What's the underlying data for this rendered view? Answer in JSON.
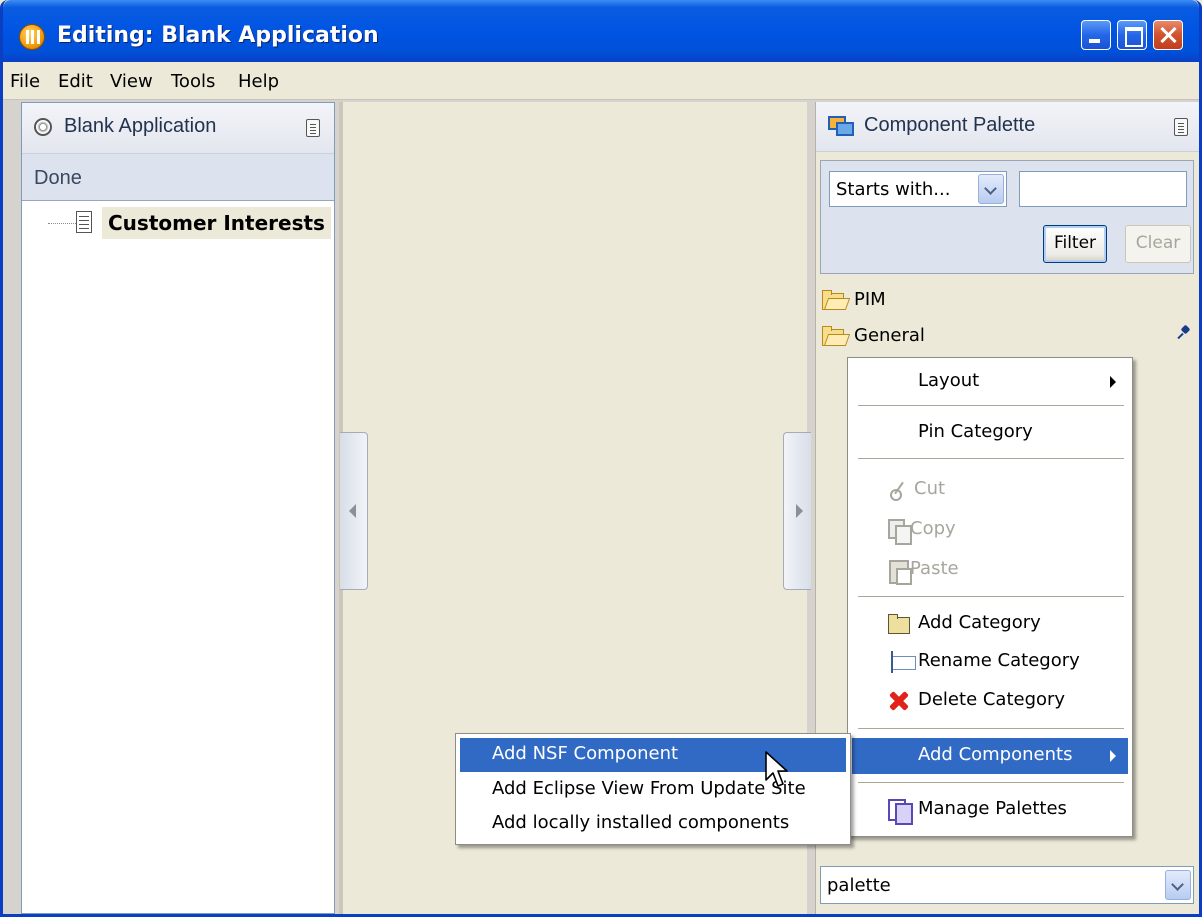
{
  "window": {
    "title": "Editing: Blank Application"
  },
  "menubar": {
    "items": [
      "File",
      "Edit",
      "View",
      "Tools",
      "Help"
    ]
  },
  "left_panel": {
    "title": "Blank Application",
    "status": "Done",
    "tree": [
      {
        "label": "Customer Interests"
      }
    ]
  },
  "right_panel": {
    "title": "Component Palette",
    "filter_mode": "Starts with...",
    "filter_text": "",
    "filter_button": "Filter",
    "clear_button": "Clear",
    "categories": [
      {
        "label": "PIM",
        "pinned": false
      },
      {
        "label": "General",
        "pinned": true
      }
    ],
    "palette_select": "palette"
  },
  "context_menu": {
    "items": [
      {
        "label": "Layout",
        "submenu": true
      },
      {
        "label": "Pin Category"
      },
      {
        "label": "Cut",
        "icon": "scissors-icon",
        "disabled": true
      },
      {
        "label": "Copy",
        "icon": "copy-icon",
        "disabled": true
      },
      {
        "label": "Paste",
        "icon": "paste-icon",
        "disabled": true
      },
      {
        "label": "Add Category",
        "icon": "folder-icon"
      },
      {
        "label": "Rename Category",
        "icon": "rename-icon"
      },
      {
        "label": "Delete Category",
        "icon": "delete-icon"
      },
      {
        "label": "Add Components",
        "submenu": true,
        "active": true
      },
      {
        "label": "Manage Palettes",
        "icon": "manage-palettes-icon"
      }
    ]
  },
  "submenu": {
    "items": [
      {
        "label": "Add NSF Component",
        "active": true
      },
      {
        "label": "Add Eclipse View From Update Site"
      },
      {
        "label": "Add locally installed components"
      }
    ]
  },
  "colors": {
    "titlebar": "#0054E3",
    "selection": "#316AC5",
    "chrome": "#ECE9D8"
  }
}
